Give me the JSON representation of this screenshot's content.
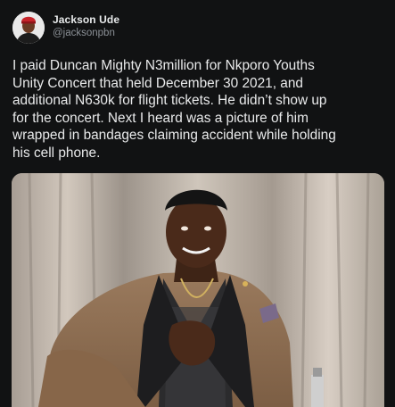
{
  "author": {
    "name": "Jackson Ude",
    "handle": "@jacksonpbn",
    "avatar": "avatar-icon"
  },
  "tweet": {
    "text": "I paid Duncan Mighty N3million for Nkporo Youths\nUnity Concert that held December 30 2021, and\nadditional N630k for flight tickets. He didn’t  show up\nfor the concert. Next I heard was a picture of him\nwrapped in bandages claiming accident while holding\nhis cell phone."
  },
  "media": {
    "type": "photo"
  },
  "colors": {
    "background": "#111213",
    "text": "#e9eaeb",
    "muted": "#8b9096"
  }
}
